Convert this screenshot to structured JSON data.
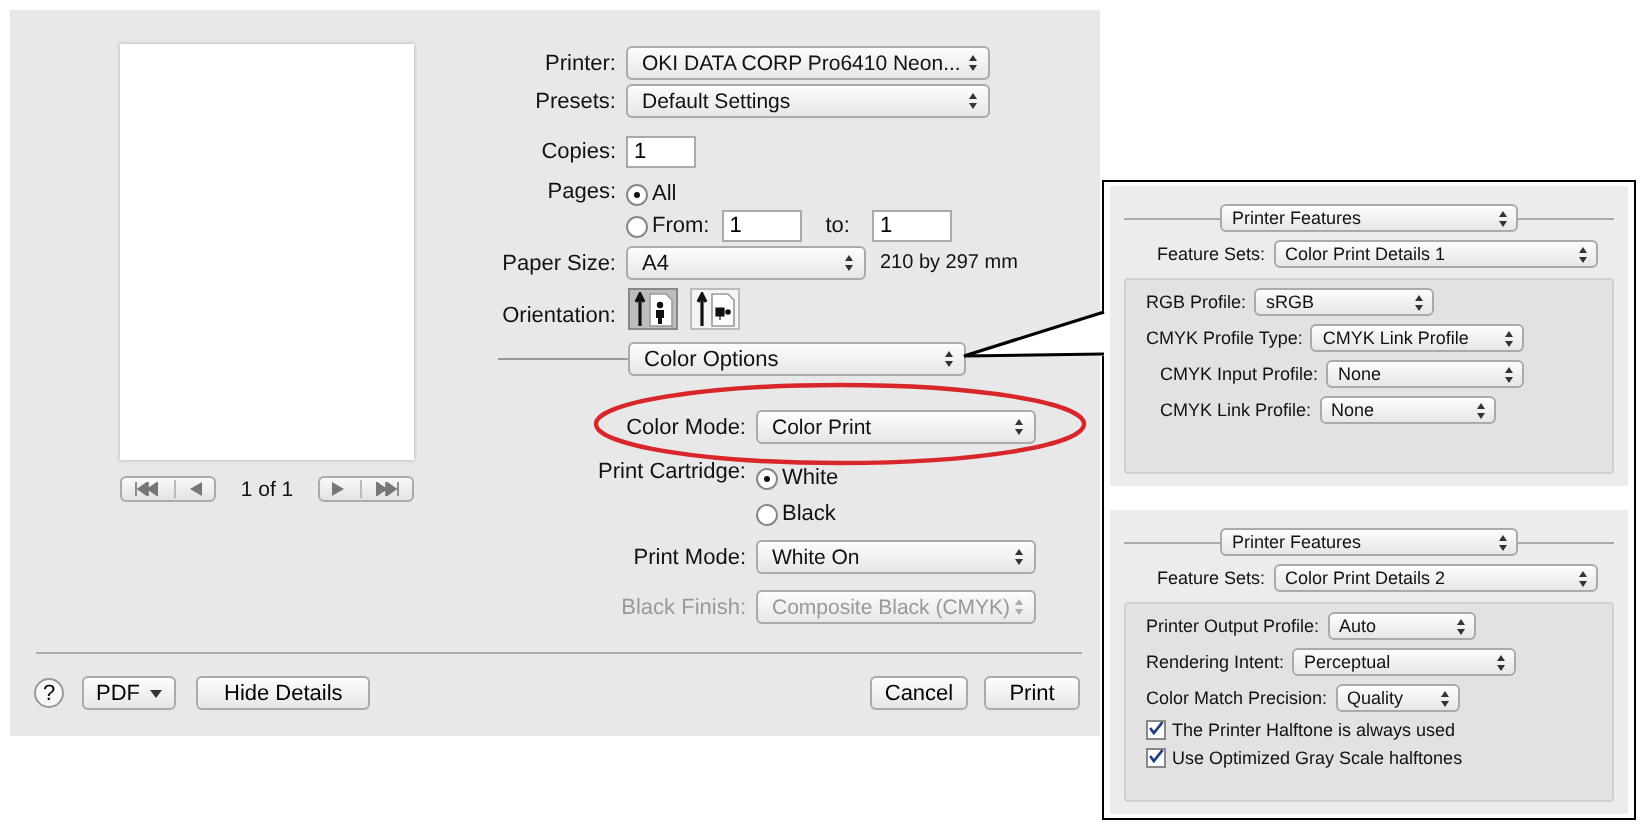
{
  "preview": {
    "page_indicator": "1 of 1"
  },
  "printer": {
    "label": "Printer:",
    "value": "OKI DATA CORP Pro6410 Neon..."
  },
  "presets": {
    "label": "Presets:",
    "value": "Default Settings"
  },
  "copies": {
    "label": "Copies:",
    "value": "1"
  },
  "pages": {
    "label": "Pages:",
    "options": [
      {
        "label": "All",
        "selected": true
      },
      {
        "label": "From:",
        "selected": false
      }
    ],
    "from": "1",
    "to_label": "to:",
    "to": "1"
  },
  "paper_size": {
    "label": "Paper Size:",
    "value": "A4",
    "dimensions": "210 by 297 mm"
  },
  "orientation": {
    "label": "Orientation:",
    "options": [
      {
        "kind": "portrait",
        "selected": true
      },
      {
        "kind": "landscape",
        "selected": false
      }
    ]
  },
  "section": {
    "value": "Color Options"
  },
  "color_settings": [
    {
      "kind": "popup",
      "label": "Color Mode:",
      "value": "Color Print",
      "disabled": false
    },
    {
      "kind": "radio",
      "label": "Print Cartridge:",
      "options": [
        {
          "label": "White",
          "selected": true
        },
        {
          "label": "Black",
          "selected": false
        }
      ]
    },
    {
      "kind": "popup",
      "label": "Print Mode:",
      "value": "White On",
      "disabled": false
    },
    {
      "kind": "popup",
      "label": "Black Finish:",
      "value": "Composite Black (CMYK)",
      "disabled": true
    }
  ],
  "buttons": {
    "help": "?",
    "pdf": "PDF",
    "hide_details": "Hide Details",
    "cancel": "Cancel",
    "print": "Print"
  },
  "callout": {
    "panels": [
      {
        "section": "Printer Features",
        "feature_sets": {
          "label": "Feature Sets:",
          "value": "Color Print Details 1"
        },
        "settings": [
          {
            "kind": "popup",
            "label": "RGB Profile:",
            "value": "sRGB"
          },
          {
            "kind": "popup",
            "label": "CMYK Profile Type:",
            "value": "CMYK Link Profile"
          },
          {
            "kind": "popup",
            "label": "CMYK Input Profile:",
            "value": "None"
          },
          {
            "kind": "popup",
            "label": "CMYK Link Profile:",
            "value": "None"
          }
        ]
      },
      {
        "section": "Printer Features",
        "feature_sets": {
          "label": "Feature Sets:",
          "value": "Color Print Details 2"
        },
        "settings": [
          {
            "kind": "popup",
            "label": "Printer Output Profile:",
            "value": "Auto"
          },
          {
            "kind": "popup",
            "label": "Rendering Intent:",
            "value": "Perceptual"
          },
          {
            "kind": "popup",
            "label": "Color Match Precision:",
            "value": "Quality"
          },
          {
            "kind": "checkbox",
            "label": "The Printer Halftone is always used",
            "checked": true
          },
          {
            "kind": "checkbox",
            "label": "Use Optimized Gray Scale halftones",
            "checked": true
          }
        ]
      }
    ]
  }
}
